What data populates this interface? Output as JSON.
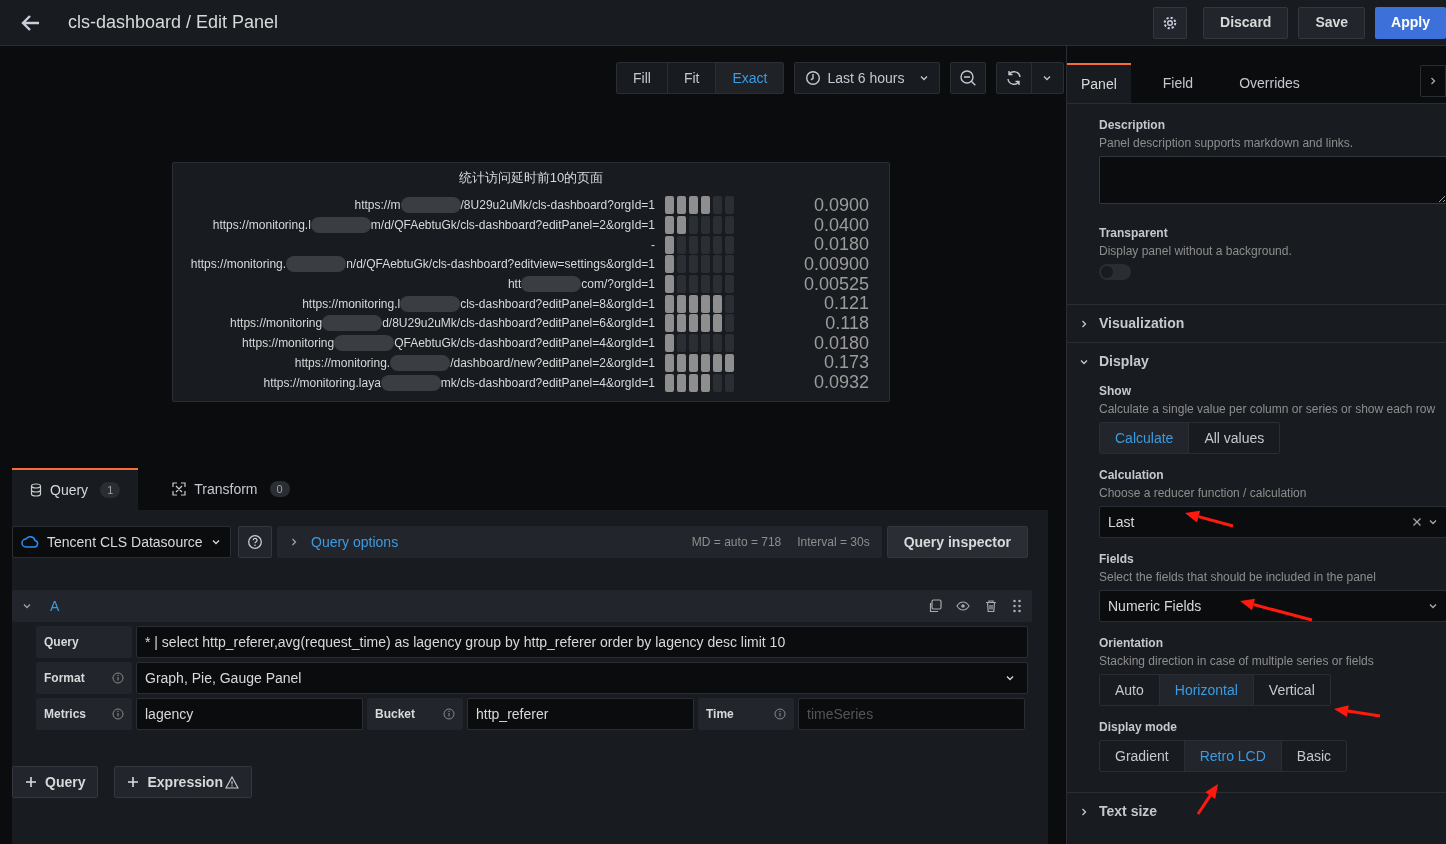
{
  "header": {
    "title": "cls-dashboard / Edit Panel",
    "buttons": [
      {
        "kind": "icon"
      },
      {
        "kind": "secondary",
        "label": "Discard"
      },
      {
        "kind": "secondary",
        "label": "Save"
      },
      {
        "kind": "primary",
        "label": "Apply"
      }
    ]
  },
  "view_modes": [
    {
      "label": "Fill",
      "selected": false
    },
    {
      "label": "Fit",
      "selected": false
    },
    {
      "label": "Exact",
      "selected": true
    }
  ],
  "time_range": "Last 6 hours",
  "panel": {
    "title": "统计访问延时前10的页面",
    "rows": [
      {
        "label_start": "https://m",
        "label_end": "/8U29u2uMk/cls-dashboard?orgId=1",
        "level": 0.67,
        "value": "0.0900"
      },
      {
        "label_start": "https://monitoring.l",
        "label_end": "m/d/QFAebtuGk/cls-dashboard?editPanel=2&orgId=1",
        "level": 0.33,
        "value": "0.0400"
      },
      {
        "label_start": "",
        "label_end": "-",
        "level": 0.17,
        "value": "0.0180"
      },
      {
        "label_start": "https://monitoring.",
        "label_end": "n/d/QFAebtuGk/cls-dashboard?editview=settings&orgId=1",
        "level": 0.17,
        "value": "0.00900"
      },
      {
        "label_start": "htt",
        "label_end": "com/?orgId=1",
        "level": 0.17,
        "value": "0.00525"
      },
      {
        "label_start": "https://monitoring.l",
        "label_end": "cls-dashboard?editPanel=8&orgId=1",
        "level": 0.83,
        "value": "0.121"
      },
      {
        "label_start": "https://monitoring",
        "label_end": "d/8U29u2uMk/cls-dashboard?editPanel=6&orgId=1",
        "level": 0.83,
        "value": "0.118"
      },
      {
        "label_start": "https://monitoring",
        "label_end": "QFAebtuGk/cls-dashboard?editPanel=4&orgId=1",
        "level": 0.17,
        "value": "0.0180"
      },
      {
        "label_start": "https://monitoring.",
        "label_end": "/dashboard/new?editPanel=2&orgId=1",
        "level": 1,
        "value": "0.173"
      },
      {
        "label_start": "https://monitoring.laya",
        "label_end": "mk/cls-dashboard?editPanel=4&orgId=1",
        "level": 0.67,
        "value": "0.0932"
      }
    ]
  },
  "query_tabs": [
    {
      "label": "Query",
      "count": "1",
      "selected": true
    },
    {
      "label": "Transform",
      "count": "0",
      "selected": false
    }
  ],
  "datasource": "Tencent CLS Datasource",
  "query_options": {
    "label": "Query options",
    "md": "MD = auto = 718",
    "interval": "Interval = 30s"
  },
  "query_inspector": "Query inspector",
  "query": {
    "ref": "A",
    "expanded": true,
    "text": {
      "label": "Query",
      "value": "* | select http_referer,avg(request_time) as lagency group by http_referer order by lagency desc limit 10"
    },
    "format": {
      "label": "Format",
      "value": "Graph, Pie, Gauge Panel"
    },
    "fields": [
      {
        "label": "Metrics",
        "value": "lagency"
      },
      {
        "label": "Bucket",
        "value": "http_referer"
      },
      {
        "label": "Time",
        "placeholder": "timeSeries"
      }
    ]
  },
  "add_buttons": [
    {
      "label": "Query",
      "warning": false
    },
    {
      "label": "Expression",
      "warning": true
    }
  ],
  "options_tabs": [
    {
      "label": "Panel",
      "selected": true
    },
    {
      "label": "Field",
      "selected": false
    },
    {
      "label": "Overrides",
      "selected": false
    }
  ],
  "description": {
    "label": "Description",
    "hint": "Panel description supports markdown and links."
  },
  "transparent": {
    "label": "Transparent",
    "hint": "Display panel without a background.",
    "on": false
  },
  "sections": [
    {
      "title": "Visualization",
      "expanded": false
    },
    {
      "title": "Display",
      "expanded": true,
      "options": [
        {
          "kind": "radio",
          "label": "Show",
          "hint": "Calculate a single value per column or series or show each row",
          "choices": [
            {
              "label": "Calculate",
              "selected": true
            },
            {
              "label": "All values",
              "selected": false
            }
          ]
        },
        {
          "kind": "select",
          "label": "Calculation",
          "hint": "Choose a reducer function / calculation",
          "value": "Last",
          "clearable": true
        },
        {
          "kind": "select",
          "label": "Fields",
          "hint": "Select the fields that should be included in the panel",
          "value": "Numeric Fields",
          "clearable": false
        },
        {
          "kind": "radio",
          "label": "Orientation",
          "hint": "Stacking direction in case of multiple series or fields",
          "choices": [
            {
              "label": "Auto",
              "selected": false
            },
            {
              "label": "Horizontal",
              "selected": true
            },
            {
              "label": "Vertical",
              "selected": false
            }
          ]
        },
        {
          "kind": "radio",
          "label": "Display mode",
          "choices": [
            {
              "label": "Gradient",
              "selected": false
            },
            {
              "label": "Retro LCD",
              "selected": true
            },
            {
              "label": "Basic",
              "selected": false
            }
          ]
        }
      ]
    },
    {
      "title": "Text size",
      "expanded": false
    }
  ]
}
